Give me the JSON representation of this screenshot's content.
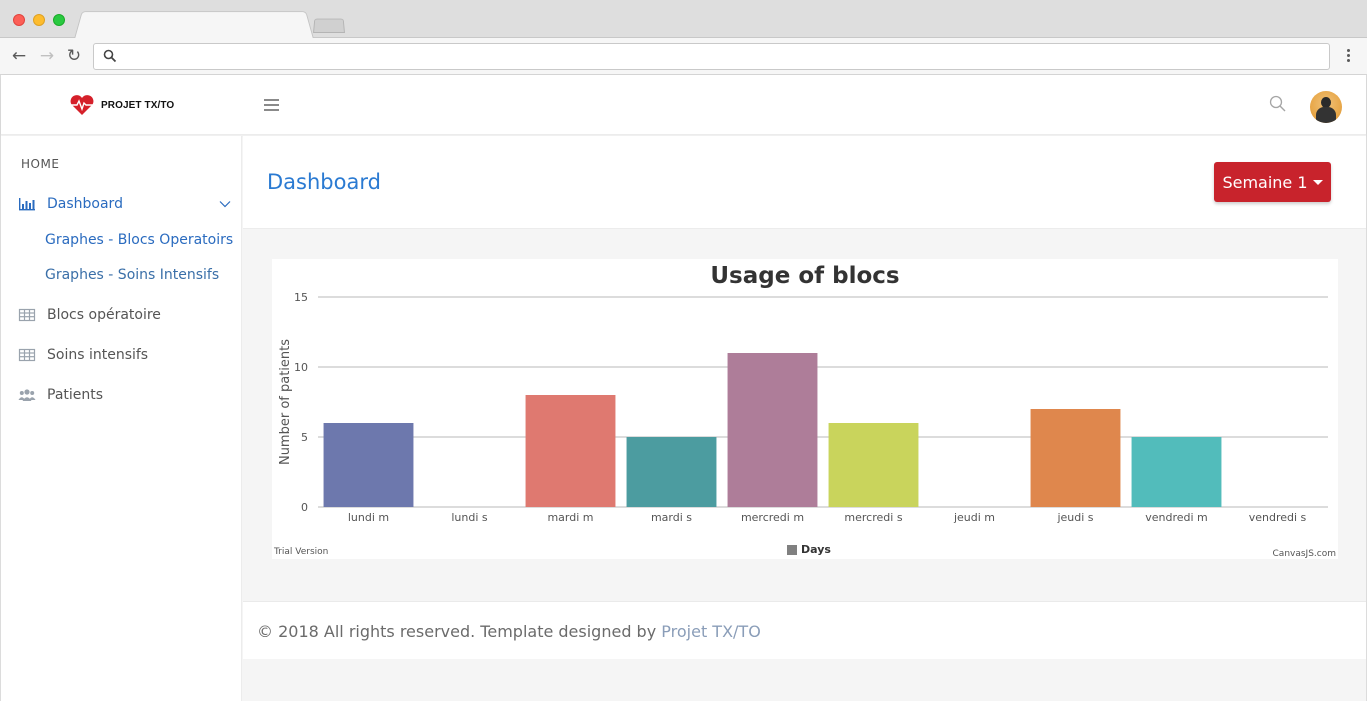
{
  "browser": {
    "url": ""
  },
  "header": {
    "logo_text": "PROJET TX/TO"
  },
  "sidebar": {
    "section_label": "HOME",
    "items": [
      {
        "label": "Dashboard",
        "icon": "bar-chart-icon",
        "expanded": true,
        "children": [
          {
            "label": "Graphes - Blocs Operatoirs"
          },
          {
            "label": "Graphes - Soins Intensifs"
          }
        ]
      },
      {
        "label": "Blocs opératoire",
        "icon": "table-icon"
      },
      {
        "label": "Soins intensifs",
        "icon": "table-icon"
      },
      {
        "label": "Patients",
        "icon": "users-icon"
      }
    ]
  },
  "main": {
    "title": "Dashboard",
    "week_button": "Semaine 1"
  },
  "chart_data": {
    "type": "bar",
    "title": "Usage of blocs",
    "xlabel": "",
    "ylabel": "Number of patients",
    "ylim": [
      0,
      15
    ],
    "yticks": [
      0,
      5,
      10,
      15
    ],
    "grid": true,
    "legend": "bottom",
    "legend_label": "Days",
    "categories": [
      "lundi m",
      "lundi s",
      "mardi m",
      "mardi s",
      "mercredi m",
      "mercredi s",
      "jeudi m",
      "jeudi s",
      "vendredi m",
      "vendredi s"
    ],
    "values": [
      6,
      0,
      8,
      5,
      11,
      6,
      0,
      7,
      5,
      0
    ],
    "colors": [
      "#6d78ad",
      "#51cda0",
      "#df7970",
      "#4c9ca0",
      "#ae7d99",
      "#c9d45c",
      "#5592ad",
      "#df874d",
      "#52bcbb",
      "#6ab4e0"
    ],
    "watermark_left": "Trial Version",
    "watermark_right": "CanvasJS.com"
  },
  "footer": {
    "text": "© 2018 All rights reserved. Template designed by ",
    "link": "Projet TX/TO"
  }
}
